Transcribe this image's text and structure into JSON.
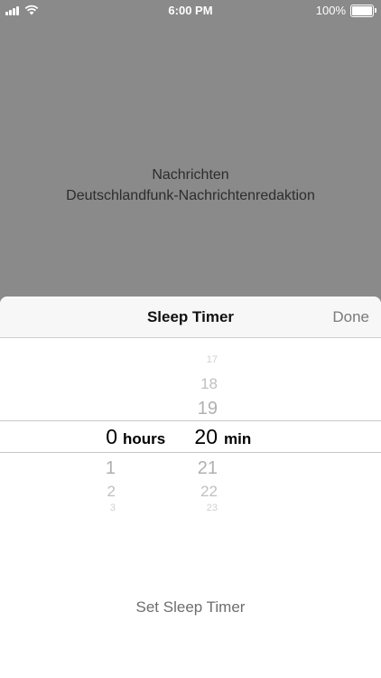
{
  "status_bar": {
    "time": "6:00 PM",
    "battery": "100%",
    "battery_level": 1.0,
    "icons": [
      "signal-icon",
      "wifi-icon",
      "battery-icon"
    ]
  },
  "background": {
    "line1": "Nachrichten",
    "line2": "Deutschlandfunk-Nachrichtenredaktion"
  },
  "sheet": {
    "title": "Sleep Timer",
    "done_label": "Done",
    "set_button_label": "Set Sleep Timer"
  },
  "picker": {
    "hours": {
      "selected": "0",
      "unit": "hours",
      "below": [
        "1",
        "2",
        "3"
      ]
    },
    "minutes": {
      "above": [
        "17",
        "18",
        "19"
      ],
      "selected": "20",
      "unit": "min",
      "below": [
        "21",
        "22",
        "23"
      ]
    }
  },
  "colors": {
    "overlay": "#8a8a8a",
    "sheet_header": "#f7f7f7",
    "accent_gray": "#7a7a7a"
  }
}
